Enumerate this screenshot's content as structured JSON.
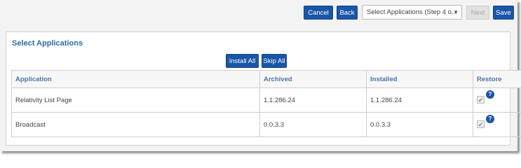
{
  "toolbar": {
    "cancel_label": "Cancel",
    "back_label": "Back",
    "step_select_value": "Select Applications (Step 4 o...",
    "next_label": "Next",
    "save_label": "Save"
  },
  "panel": {
    "title": "Select Applications",
    "install_all_label": "Install All",
    "skip_all_label": "Skip All"
  },
  "table": {
    "columns": [
      "Application",
      "Archived",
      "Installed",
      "Restore"
    ],
    "rows": [
      {
        "application": "Relativity List Page",
        "archived": "1.1.286.24",
        "installed": "1.1.286.24",
        "restore_checked": true
      },
      {
        "application": "Broadcast",
        "archived": "0.0.3.3",
        "installed": "0.0.3.3",
        "restore_checked": true
      }
    ]
  },
  "icons": {
    "checkbox": "check-icon",
    "help": "help-icon",
    "dropdown": "chevron-down-icon"
  },
  "colors": {
    "primary_button": "#1a56a8",
    "header_text": "#4a74a9",
    "title_text": "#2f6aa8"
  }
}
